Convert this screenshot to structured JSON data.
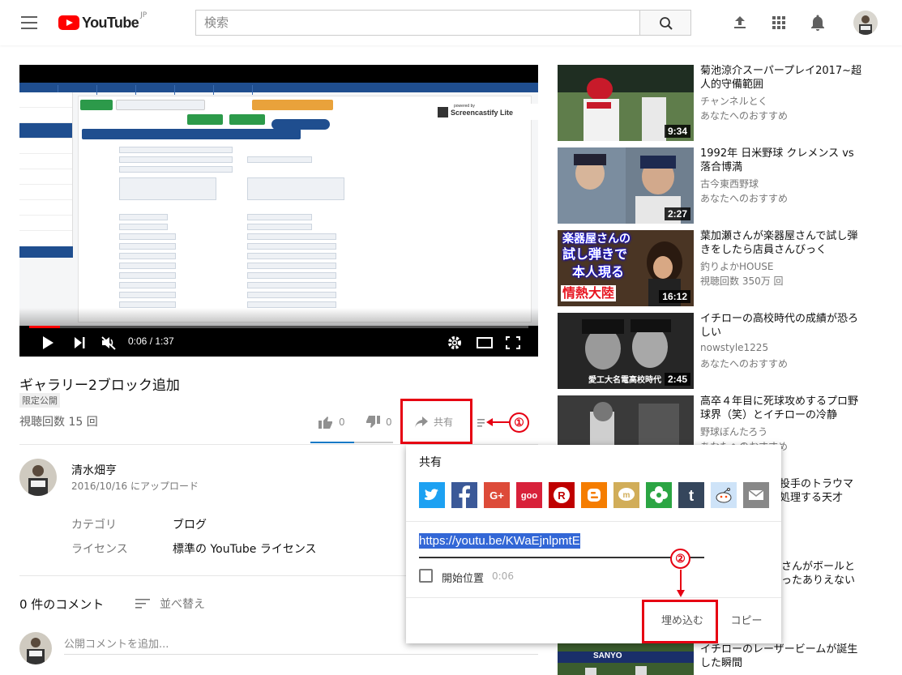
{
  "header": {
    "logo_text": "YouTube",
    "region": "JP",
    "search_placeholder": "検索"
  },
  "player": {
    "current_time": "0:06",
    "duration": "1:37",
    "time_display": "0:06 / 1:37",
    "progress_fraction": 0.062,
    "watermark_small": "powered by",
    "watermark": "Screencastify Lite"
  },
  "video": {
    "title": "ギャラリー2ブロック追加",
    "privacy_badge": "限定公開",
    "views": "視聴回数 15 回",
    "likes": "0",
    "dislikes": "0",
    "share_label": "共有",
    "like_fraction": 0.53
  },
  "owner": {
    "name": "清水畑亨",
    "upload_date": "2016/10/16 にアップロード",
    "category_label": "カテゴリ",
    "category_value": "ブログ",
    "license_label": "ライセンス",
    "license_value": "標準の YouTube ライセンス"
  },
  "comments": {
    "count": "0 件のコメント",
    "sort_label": "並べ替え",
    "placeholder": "公開コメントを追加..."
  },
  "recommendations": [
    {
      "title": "菊池涼介スーパープレイ2017~超人的守備範囲",
      "channel": "チャンネルとく",
      "meta": "あなたへのおすすめ",
      "duration": "9:34"
    },
    {
      "title": "1992年 日米野球 クレメンス vs 落合博満",
      "channel": "古今東西野球",
      "meta": "あなたへのおすすめ",
      "duration": "2:27"
    },
    {
      "title": "葉加瀬さんが楽器屋さんで試し弾きをしたら店員さんびっく",
      "channel": "釣りよかHOUSE",
      "meta": "視聴回数 350万 回",
      "duration": "16:12",
      "thumb_text_1": "楽器屋さんの",
      "thumb_text_2": "試し弾きで",
      "thumb_text_3": "本人現る",
      "thumb_text_4": "情熱大陸"
    },
    {
      "title": "イチローの高校時代の成績が恐ろしい",
      "channel": "nowstyle1225",
      "meta": "あなたへのおすすめ",
      "duration": "2:45",
      "thumb_caption": "愛工大名電高校時代"
    },
    {
      "title": "高卒４年目に死球攻めするプロ野球界（笑）とイチローの冷静",
      "channel": "野球ぼんたろう",
      "meta": "あなたへのおすすめ",
      "duration": ""
    },
    {
      "title_fragment_1": "投手のトラウマ",
      "title_fragment_2": "処理する天才"
    },
    {
      "title_fragment_1": "さんがボールと",
      "title_fragment_2": "ったありえない"
    },
    {
      "title": "イチローのレーザービームが誕生した瞬間",
      "thumb_text": "SANYO"
    }
  ],
  "share_dialog": {
    "title": "共有",
    "services": [
      {
        "name": "twitter",
        "color": "#1da1f2",
        "glyph": "t"
      },
      {
        "name": "facebook",
        "color": "#3b5998",
        "glyph": "f"
      },
      {
        "name": "google-plus",
        "color": "#dd4b39",
        "glyph": "G+"
      },
      {
        "name": "goo",
        "color": "#d8213a",
        "glyph": "goo"
      },
      {
        "name": "rakuten",
        "color": "#bf0000",
        "glyph": "R"
      },
      {
        "name": "blogger",
        "color": "#f57d00",
        "glyph": "B"
      },
      {
        "name": "mixi",
        "color": "#d1ad59",
        "glyph": "m"
      },
      {
        "name": "kakao",
        "color": "#2ba543",
        "glyph": "✿"
      },
      {
        "name": "tumblr",
        "color": "#35465c",
        "glyph": "t"
      },
      {
        "name": "reddit",
        "color": "#cee3f8",
        "glyph": "☺"
      },
      {
        "name": "email",
        "color": "#888888",
        "glyph": "✉"
      }
    ],
    "url": "https://youtu.be/KWaEjnlpmtE",
    "start_label": "開始位置",
    "start_time": "0:06",
    "embed_label": "埋め込む",
    "copy_label": "コピー"
  },
  "annotations": {
    "marker_1": "①",
    "marker_2": "②",
    "color": "#e60012"
  }
}
